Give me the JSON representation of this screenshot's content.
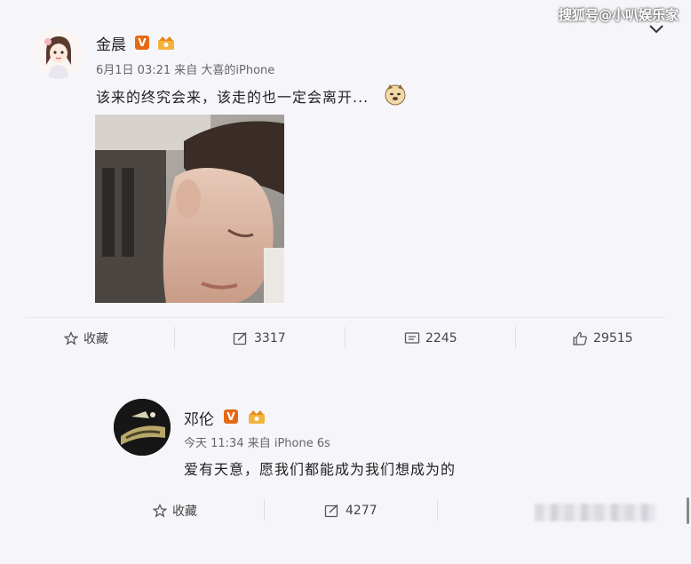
{
  "watermark": "搜狐号@小叭娱乐家",
  "post1": {
    "username": "金晨",
    "meta": "6月1日 03:21 来自 大喜的iPhone",
    "text": "该来的终究会来，该走的也一定会离开...",
    "emoji_icon": "doge-emoji-icon",
    "actions": {
      "favorite": "收藏",
      "repost": "3317",
      "comment": "2245",
      "like": "29515"
    }
  },
  "post2": {
    "username": "邓伦",
    "meta": "今天 11:34 来自 iPhone 6s",
    "text": "爱有天意，愿我们都能成为我们想成为的",
    "actions": {
      "favorite": "收藏",
      "repost": "4277"
    }
  },
  "colors": {
    "background": "#f6f6fa",
    "verified_badge": "#e46a14",
    "text": "#222222",
    "meta": "#666666"
  }
}
